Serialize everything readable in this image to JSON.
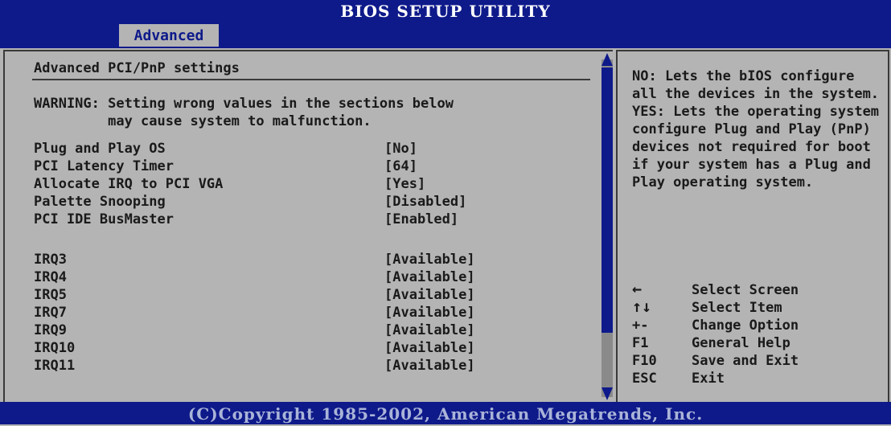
{
  "header": {
    "title": "BIOS SETUP UTILITY",
    "active_tab": "Advanced"
  },
  "main": {
    "section_title": "Advanced PCI/PnP settings",
    "warning_line1": "WARNING: Setting wrong values in the sections below",
    "warning_line2": "         may cause system to malfunction.",
    "settings": [
      {
        "label": "Plug and Play OS",
        "value": "[No]"
      },
      {
        "label": "PCI Latency Timer",
        "value": "[64]"
      },
      {
        "label": "Allocate IRQ to PCI VGA",
        "value": "[Yes]"
      },
      {
        "label": "Palette Snooping",
        "value": "[Disabled]"
      },
      {
        "label": "PCI IDE BusMaster",
        "value": "[Enabled]"
      }
    ],
    "irqs": [
      {
        "label": "IRQ3",
        "value": "[Available]"
      },
      {
        "label": "IRQ4",
        "value": "[Available]"
      },
      {
        "label": "IRQ5",
        "value": "[Available]"
      },
      {
        "label": "IRQ7",
        "value": "[Available]"
      },
      {
        "label": "IRQ9",
        "value": "[Available]"
      },
      {
        "label": "IRQ10",
        "value": "[Available]"
      },
      {
        "label": "IRQ11",
        "value": "[Available]"
      }
    ]
  },
  "help": {
    "text": "NO: Lets the bIOS configure all the devices in the system. YES: Lets the operating system configure Plug and Play (PnP) devices not required for boot if your system has a Plug and Play operating system.",
    "keys": [
      {
        "key": "←",
        "desc": "Select Screen"
      },
      {
        "key": "↑↓",
        "desc": "Select Item"
      },
      {
        "key": "+-",
        "desc": "Change Option"
      },
      {
        "key": "F1",
        "desc": "General Help"
      },
      {
        "key": "F10",
        "desc": "Save and Exit"
      },
      {
        "key": "ESC",
        "desc": "Exit"
      }
    ]
  },
  "footer": {
    "copyright": "(C)Copyright 1985-2002, American Megatrends, Inc."
  },
  "colors": {
    "header_bg": "#0e1a8a",
    "panel_bg": "#b4b4b4",
    "text": "#1a1a1a"
  }
}
